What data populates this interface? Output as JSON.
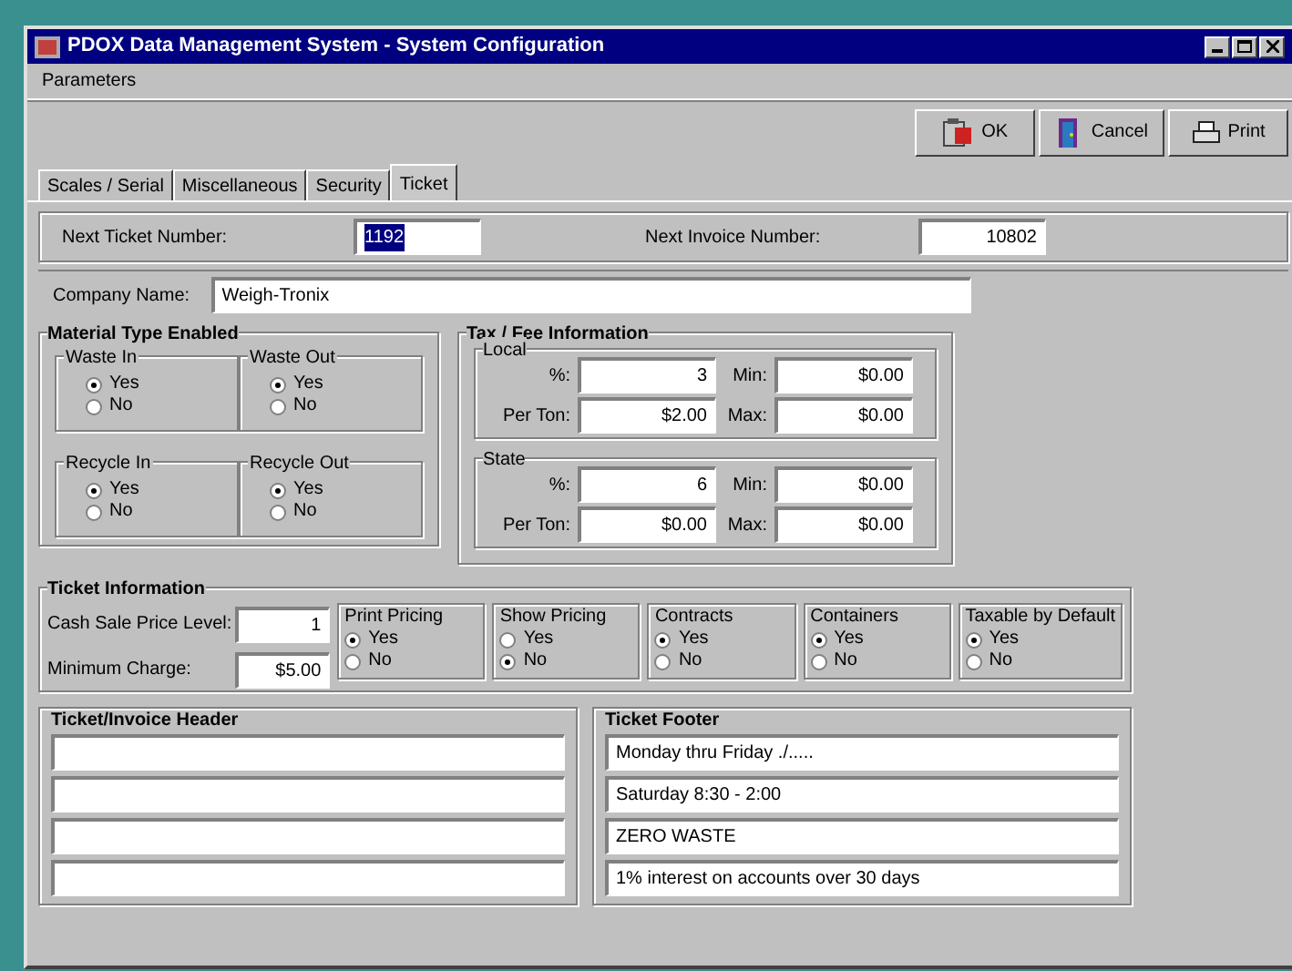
{
  "window": {
    "title": "PDOX Data Management System - System Configuration"
  },
  "menu": [
    "Parameters"
  ],
  "toolbar": [
    {
      "label": "OK",
      "kind": "ok"
    },
    {
      "label": "Cancel",
      "kind": "cancel"
    },
    {
      "label": "Print",
      "kind": "print"
    }
  ],
  "tabs": [
    {
      "label": "Scales / Serial",
      "selected": false
    },
    {
      "label": "Miscellaneous",
      "selected": false
    },
    {
      "label": "Security",
      "selected": false
    },
    {
      "label": "Ticket",
      "selected": true
    }
  ],
  "numbers": [
    {
      "label": "Next Ticket Number:",
      "value": "1192",
      "highlighted": true
    },
    {
      "label": "Next Invoice Number:",
      "value": "10802",
      "highlighted": false
    }
  ],
  "company": {
    "label": "Company Name:",
    "value": "Weigh-Tronix"
  },
  "material": {
    "title": "Material Type Enabled",
    "groups": [
      {
        "title": "Waste In",
        "options": [
          {
            "label": "Yes",
            "selected": true
          },
          {
            "label": "No",
            "selected": false
          }
        ]
      },
      {
        "title": "Waste Out",
        "options": [
          {
            "label": "Yes",
            "selected": true
          },
          {
            "label": "No",
            "selected": false
          }
        ]
      },
      {
        "title": "Recycle In",
        "options": [
          {
            "label": "Yes",
            "selected": true
          },
          {
            "label": "No",
            "selected": false
          }
        ]
      },
      {
        "title": "Recycle Out",
        "options": [
          {
            "label": "Yes",
            "selected": true
          },
          {
            "label": "No",
            "selected": false
          }
        ]
      }
    ]
  },
  "tax": {
    "title": "Tax / Fee Information",
    "groups": [
      {
        "title": "Local",
        "fields": [
          {
            "label": "%:",
            "value": "3"
          },
          {
            "label": "Min:",
            "value": "$0.00"
          },
          {
            "label": "Per Ton:",
            "value": "$2.00"
          },
          {
            "label": "Max:",
            "value": "$0.00"
          }
        ]
      },
      {
        "title": "State",
        "fields": [
          {
            "label": "%:",
            "value": "6"
          },
          {
            "label": "Min:",
            "value": "$0.00"
          },
          {
            "label": "Per Ton:",
            "value": "$0.00"
          },
          {
            "label": "Max:",
            "value": "$0.00"
          }
        ]
      }
    ]
  },
  "ticket_info": {
    "title": "Ticket Information",
    "fields": [
      {
        "label": "Cash Sale Price Level:",
        "value": "1"
      },
      {
        "label": "Minimum Charge:",
        "value": "$5.00"
      }
    ],
    "groups": [
      {
        "title": "Print Pricing",
        "options": [
          {
            "label": "Yes",
            "selected": true
          },
          {
            "label": "No",
            "selected": false
          }
        ]
      },
      {
        "title": "Show Pricing",
        "options": [
          {
            "label": "Yes",
            "selected": false
          },
          {
            "label": "No",
            "selected": true
          }
        ]
      },
      {
        "title": "Contracts",
        "options": [
          {
            "label": "Yes",
            "selected": true
          },
          {
            "label": "No",
            "selected": false
          }
        ]
      },
      {
        "title": "Containers",
        "options": [
          {
            "label": "Yes",
            "selected": true
          },
          {
            "label": "No",
            "selected": false
          }
        ]
      },
      {
        "title": "Taxable by Default",
        "options": [
          {
            "label": "Yes",
            "selected": true
          },
          {
            "label": "No",
            "selected": false
          }
        ]
      }
    ]
  },
  "header": {
    "title": "Ticket/Invoice Header",
    "lines": [
      {
        "kind": "field"
      },
      {
        "kind": "field"
      },
      {
        "kind": "field"
      },
      {
        "kind": "field"
      }
    ]
  },
  "footer": {
    "title": "Ticket Footer",
    "lines": [
      {
        "value": "Monday thru Friday ./....."
      },
      {
        "value": "Saturday 8:30 - 2:00"
      },
      {
        "value": "ZERO WASTE"
      },
      {
        "value": "1% interest on accounts over 30 days"
      }
    ]
  }
}
